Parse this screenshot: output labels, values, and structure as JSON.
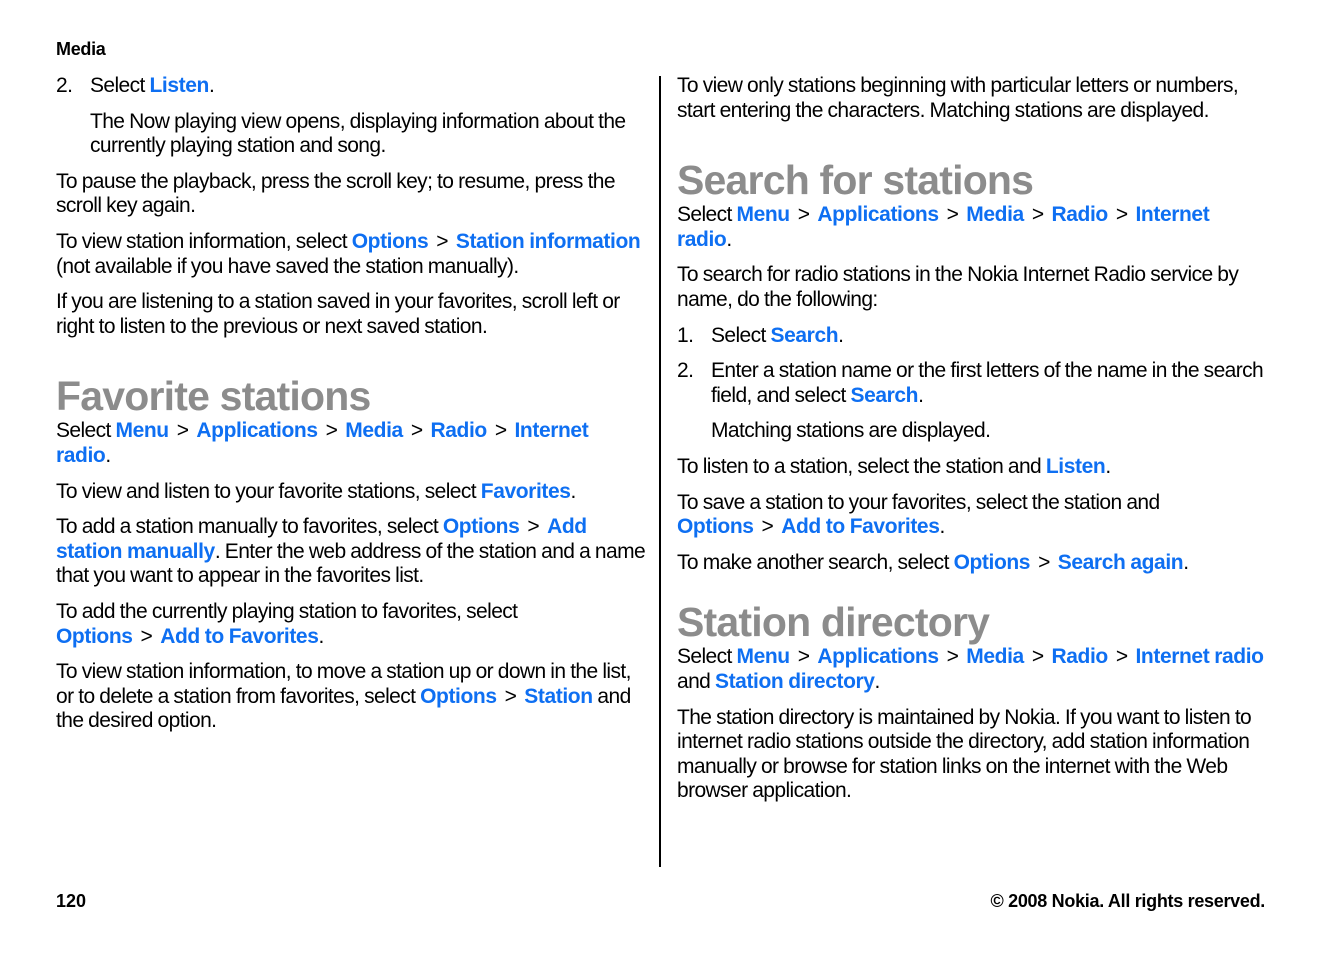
{
  "header": {
    "section": "Media"
  },
  "left_column": {
    "step2": {
      "num": "2.",
      "pre": "Select ",
      "link": "Listen",
      "post": "."
    },
    "step2_detail": "The Now playing view opens, displaying information about the currently playing station and song.",
    "pause_text": "To pause the playback, press the scroll key; to resume, press the scroll key again.",
    "station_info": {
      "pre": "To view station information, select ",
      "link1": "Options",
      "sep": ">",
      "link2": "Station information",
      "post": " (not available if you have saved the station manually)."
    },
    "favorites_scroll": "If you are listening to a station saved in your favorites, scroll left or right to listen to the previous or next saved station.",
    "favorites_heading": "Favorite stations",
    "fav_path": {
      "pre": "Select ",
      "items": [
        "Menu",
        "Applications",
        "Media",
        "Radio",
        "Internet radio"
      ],
      "sep": ">",
      "post": "."
    },
    "fav_view": {
      "pre": "To view and listen to your favorite stations, select ",
      "link": "Favorites",
      "post": "."
    },
    "fav_add_manual": {
      "pre": "To add a station manually to favorites, select ",
      "link1": "Options",
      "sep": ">",
      "link2": "Add station manually",
      "post": ". Enter the web address of the station and a name that you want to appear in the favorites list."
    },
    "fav_add_playing": {
      "pre": "To add the currently playing station to favorites, select ",
      "link1": "Options",
      "sep": ">",
      "link2": "Add to Favorites",
      "post": "."
    },
    "fav_manage": {
      "pre": "To view station information, to move a station up or down in the list, or to delete a station from favorites, select ",
      "link1": "Options",
      "sep": ">",
      "link2": "Station",
      "post": " and the desired option."
    }
  },
  "right_column": {
    "filter_text": "To view only stations beginning with particular letters or numbers, start entering the characters. Matching stations are displayed.",
    "search_heading": "Search for stations",
    "search_path": {
      "pre": "Select ",
      "items": [
        "Menu",
        "Applications",
        "Media",
        "Radio",
        "Internet radio"
      ],
      "sep": ">",
      "post": "."
    },
    "search_intro": "To search for radio stations in the Nokia Internet Radio service by name, do the following:",
    "search_step1": {
      "num": "1.",
      "pre": "Select ",
      "link": "Search",
      "post": "."
    },
    "search_step2": {
      "num": "2.",
      "pre": "Enter a station name or the first letters of the name in the search field, and select ",
      "link": "Search",
      "post": "."
    },
    "search_step2_detail": "Matching stations are displayed.",
    "listen_text": {
      "pre": "To listen to a station, select the station and ",
      "link": "Listen",
      "post": "."
    },
    "save_text": {
      "pre": "To save a station to your favorites, select the station and ",
      "link1": "Options",
      "sep": ">",
      "link2": "Add to Favorites",
      "post": "."
    },
    "again_text": {
      "pre": "To make another search, select ",
      "link1": "Options",
      "sep": ">",
      "link2": "Search again",
      "post": "."
    },
    "directory_heading": "Station directory",
    "dir_path": {
      "pre": "Select ",
      "items": [
        "Menu",
        "Applications",
        "Media",
        "Radio",
        "Internet radio"
      ],
      "sep": ">",
      "mid": " and ",
      "link_extra": "Station directory",
      "post": "."
    },
    "dir_text": "The station directory is maintained by Nokia. If you want to listen to internet radio stations outside the directory, add station information manually or browse for station links on the internet with the Web browser application."
  },
  "footer": {
    "page_number": "120",
    "copyright": "© 2008 Nokia. All rights reserved."
  },
  "colors": {
    "link": "#0e6ff2",
    "heading": "#8c8c8c",
    "text": "#000000"
  }
}
